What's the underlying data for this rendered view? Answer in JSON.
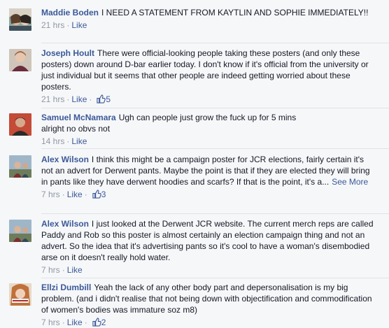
{
  "comments": [
    {
      "author": "Maddie Boden",
      "text": "I NEED A STATEMENT FROM KAYTLIN AND SOPHIE IMMEDIATELY!!",
      "time": "21 hrs",
      "like_label": "Like",
      "likes": ""
    },
    {
      "author": "Joseph Hoult",
      "text": "There were official-looking people taking these posters (and only these posters) down around D-bar earlier today. I don't know if it's official from the university or just individual but it seems that other people are indeed getting worried about these posters.",
      "time": "21 hrs",
      "like_label": "Like",
      "likes": "5"
    },
    {
      "author": "Samuel McNamara",
      "text": "Ugh can people just grow the fuck up for 5 mins\nalright no obvs not",
      "time": "14 hrs",
      "like_label": "Like",
      "likes": ""
    },
    {
      "author": "Alex Wilson",
      "text": "I think this might be a campaign poster for JCR elections, fairly certain it's not an advert for Derwent pants. Maybe the point is that if they are elected they will bring in pants like they have derwent hoodies and scarfs? If that is the point, it's a...",
      "see_more": "See More",
      "time": "7 hrs",
      "like_label": "Like",
      "likes": "3"
    },
    {
      "author": "Alex Wilson",
      "text": "I just looked at the Derwent JCR website. The current merch reps are called Paddy and Rob so this poster is almost certainly an election campaign thing and not an advert. So the idea that it's advertising pants so it's cool to have a woman's disembodied arse on it doesn't really hold water.",
      "time": "7 hrs",
      "like_label": "Like",
      "likes": ""
    },
    {
      "author": "Ellzi Dumbill",
      "text": "Yeah the lack of any other body part and depersonalisation is my big problem. (and i didn't realise that not being down with objectification and commodification of women's bodies was immature soz m8)",
      "time": "7 hrs",
      "like_label": "Like",
      "likes": "2"
    }
  ],
  "colors": {
    "link": "#3b5998",
    "meta": "#9197a3",
    "background": "#f6f7f9",
    "divider": "#e1e2e3"
  }
}
